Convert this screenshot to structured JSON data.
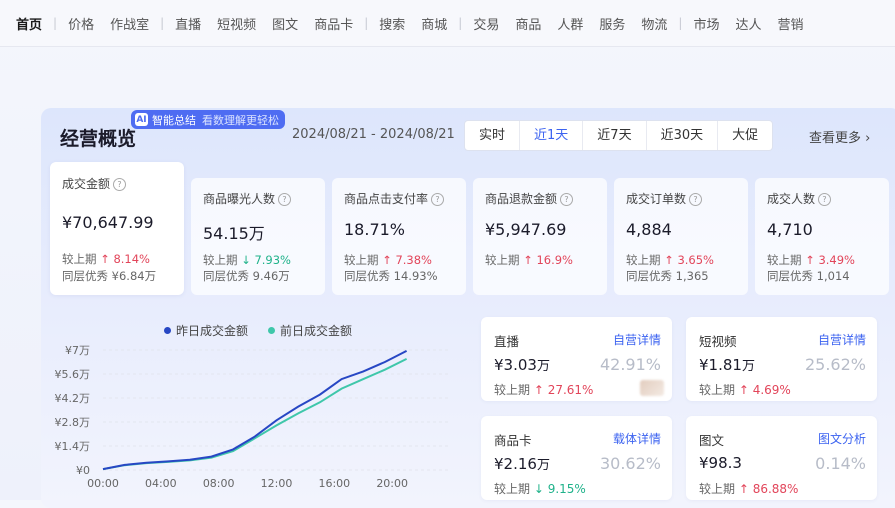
{
  "nav": {
    "items": [
      "首页",
      "价格",
      "作战室",
      "直播",
      "短视频",
      "图文",
      "商品卡",
      "搜索",
      "商城",
      "交易",
      "商品",
      "人群",
      "服务",
      "物流",
      "市场",
      "达人",
      "营销"
    ],
    "separators_after": [
      0,
      2,
      6,
      8,
      13
    ]
  },
  "overview": {
    "title": "经营概览",
    "ai_badge": "智能总结",
    "ai_badge_icon": "AI",
    "ai_subtitle": "看数理解更轻松",
    "date_range": "2024/08/21 - 2024/08/21",
    "range_tabs": [
      "实时",
      "近1天",
      "近7天",
      "近30天",
      "大促"
    ],
    "active_tab": 1,
    "see_more": "查看更多 ›"
  },
  "metrics": [
    {
      "label": "成交金额",
      "value": "¥70,647.99",
      "change_label": "较上期",
      "change_dir": "up",
      "change": "8.14%",
      "peer_label": "同层优秀",
      "peer": "¥6.84万",
      "active": true
    },
    {
      "label": "商品曝光人数",
      "value": "54.15万",
      "change_label": "较上期",
      "change_dir": "down",
      "change": "7.93%",
      "peer_label": "同层优秀",
      "peer": "9.46万"
    },
    {
      "label": "商品点击支付率",
      "value": "18.71%",
      "change_label": "较上期",
      "change_dir": "up",
      "change": "7.38%",
      "peer_label": "同层优秀",
      "peer": "14.93%"
    },
    {
      "label": "商品退款金额",
      "value": "¥5,947.69",
      "change_label": "较上期",
      "change_dir": "up",
      "change": "16.9%",
      "peer_label": "",
      "peer": ""
    },
    {
      "label": "成交订单数",
      "value": "4,884",
      "change_label": "较上期",
      "change_dir": "up",
      "change": "3.65%",
      "peer_label": "同层优秀",
      "peer": "1,365"
    },
    {
      "label": "成交人数",
      "value": "4,710",
      "change_label": "较上期",
      "change_dir": "up",
      "change": "3.49%",
      "peer_label": "同层优秀",
      "peer": "1,014"
    }
  ],
  "chart_data": {
    "type": "line",
    "series": [
      {
        "name": "昨日成交金额",
        "color": "#2747c4",
        "values": [
          0.05,
          0.3,
          0.42,
          0.5,
          0.6,
          0.78,
          1.2,
          1.95,
          2.9,
          3.7,
          4.4,
          5.3,
          5.75,
          6.3,
          6.95
        ]
      },
      {
        "name": "前日成交金额",
        "color": "#3fc7aa",
        "values": [
          0.05,
          0.28,
          0.4,
          0.47,
          0.56,
          0.72,
          1.1,
          1.85,
          2.6,
          3.3,
          3.95,
          4.75,
          5.3,
          5.85,
          6.48
        ]
      }
    ],
    "x": [
      0,
      1.5,
      3,
      4.5,
      6,
      7.5,
      9,
      10.5,
      12,
      13.5,
      15,
      16.5,
      18,
      19.5,
      21
    ],
    "xticks": [
      "00:00",
      "04:00",
      "08:00",
      "12:00",
      "16:00",
      "20:00"
    ],
    "yticks": [
      "¥0",
      "¥1.4万",
      "¥2.8万",
      "¥4.2万",
      "¥5.6万",
      "¥7万"
    ],
    "ylim": [
      0,
      7
    ],
    "grid": true,
    "legend": "top"
  },
  "channels": [
    {
      "name": "直播",
      "link": "自营详情",
      "value": "¥3.03",
      "unit": "万",
      "share": "42.91%",
      "change_label": "较上期",
      "change_dir": "up",
      "change": "27.61%"
    },
    {
      "name": "短视频",
      "link": "自营详情",
      "value": "¥1.81",
      "unit": "万",
      "share": "25.62%",
      "change_label": "较上期",
      "change_dir": "up",
      "change": "4.69%"
    },
    {
      "name": "商品卡",
      "link": "载体详情",
      "value": "¥2.16",
      "unit": "万",
      "share": "30.62%",
      "change_label": "较上期",
      "change_dir": "down",
      "change": "9.15%"
    },
    {
      "name": "图文",
      "link": "图文分析",
      "value": "¥98.3",
      "unit": "",
      "share": "0.14%",
      "change_label": "较上期",
      "change_dir": "up",
      "change": "86.88%"
    }
  ]
}
